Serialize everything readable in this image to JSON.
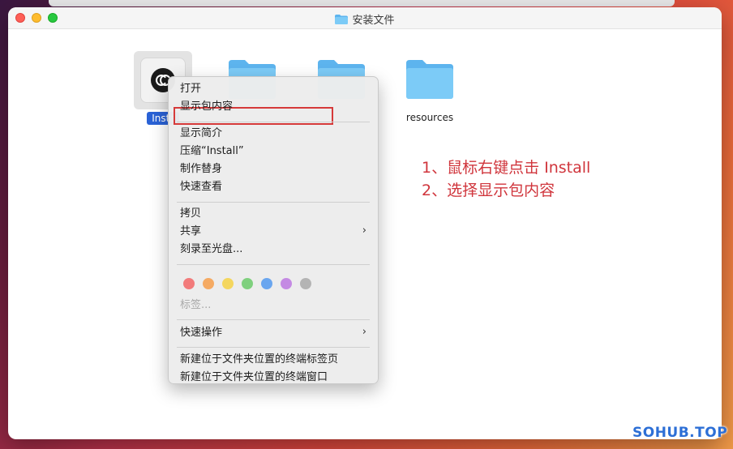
{
  "window": {
    "title": "安装文件"
  },
  "files": {
    "app_label": "Insta",
    "resources_label": "resources"
  },
  "context_menu": {
    "open": "打开",
    "show_package_contents": "显示包内容",
    "get_info": "显示简介",
    "compress": "压缩“Install”",
    "make_alias": "制作替身",
    "quick_look": "快速查看",
    "copy": "拷贝",
    "share": "共享",
    "burn": "刻录至光盘...",
    "tags": "标签...",
    "quick_actions": "快速操作",
    "new_terminal_tab": "新建位于文件夹位置的终端标签页",
    "new_terminal_window": "新建位于文件夹位置的终端窗口",
    "chevron": "›",
    "tag_colors": [
      "#f27b7b",
      "#f5aa63",
      "#f4d65e",
      "#7fd07e",
      "#6aa6ef",
      "#c48ae3",
      "#b4b4b4"
    ]
  },
  "annotation": {
    "line1": "1、鼠标右键点击 Install",
    "line2": "2、选择显示包内容"
  },
  "watermark": "SOHUB.TOP",
  "colors": {
    "accent": "#2a62d6",
    "annotation_red": "#d0353c",
    "folder_blue": "#6fc2f5"
  }
}
